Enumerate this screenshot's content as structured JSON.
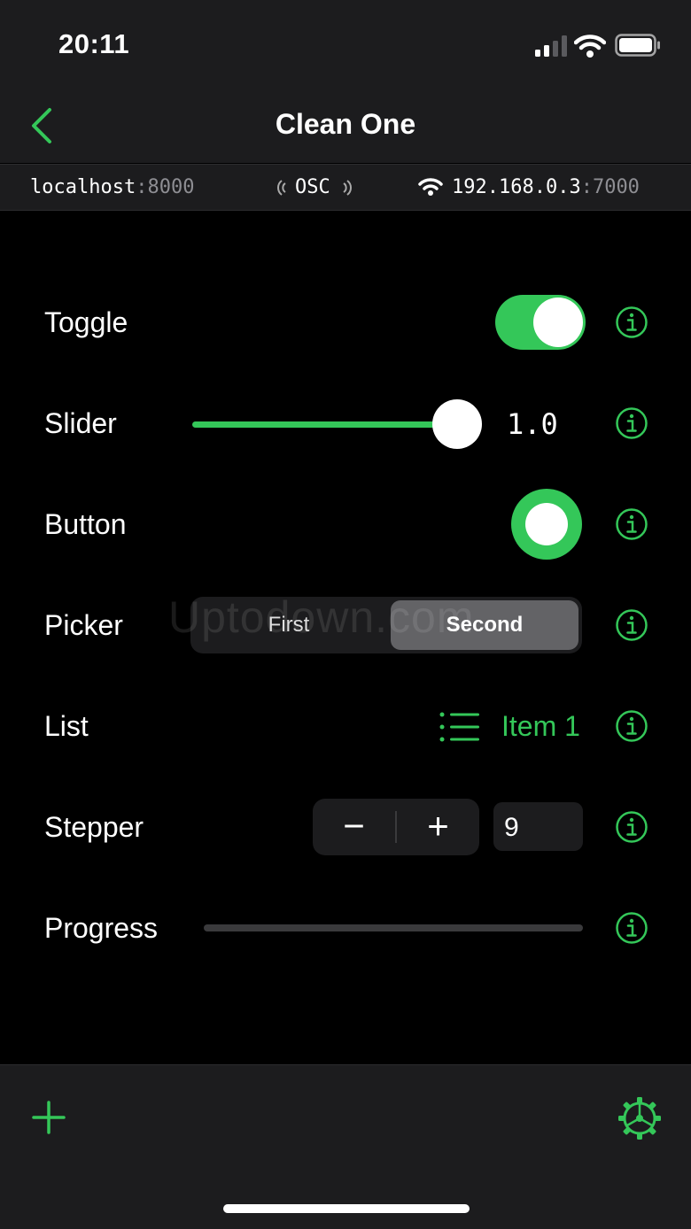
{
  "status_bar": {
    "time": "20:11"
  },
  "nav": {
    "title": "Clean One"
  },
  "connection": {
    "local_host": "localhost",
    "local_port": ":8000",
    "protocol": "OSC",
    "remote_host": "192.168.0.3",
    "remote_port": ":7000"
  },
  "rows": {
    "toggle": {
      "label": "Toggle",
      "value": true
    },
    "slider": {
      "label": "Slider",
      "value": "1.0",
      "level": 1.0
    },
    "button": {
      "label": "Button"
    },
    "picker": {
      "label": "Picker",
      "options": [
        "First",
        "Second"
      ],
      "selected": "Second"
    },
    "list": {
      "label": "List",
      "value": "Item 1"
    },
    "stepper": {
      "label": "Stepper",
      "minus": "−",
      "plus": "+",
      "value": "9"
    },
    "progress": {
      "label": "Progress",
      "level": 0.0
    }
  },
  "watermark": "Uptodown.com",
  "colors": {
    "accent": "#34c759",
    "background": "#000000",
    "bar": "#1c1c1e"
  },
  "icons": {
    "back": "chevron-left-icon",
    "info": "info-circle-icon",
    "list": "list-bullet-icon",
    "add": "plus-icon",
    "settings": "gear-icon"
  }
}
